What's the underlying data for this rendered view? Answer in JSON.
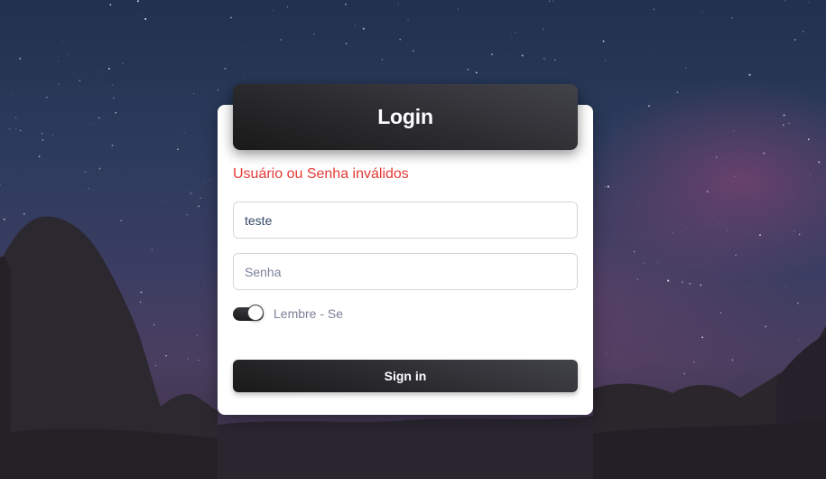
{
  "login": {
    "title": "Login",
    "error_message": "Usuário ou Senha inválidos",
    "username": {
      "value": "teste",
      "placeholder": ""
    },
    "password": {
      "value": "",
      "placeholder": "Senha"
    },
    "remember": {
      "label": "Lembre - Se",
      "checked": true
    },
    "signin_label": "Sign in"
  },
  "colors": {
    "error": "#e53935",
    "dark_gradient_start": "#42424a",
    "dark_gradient_end": "#191919"
  }
}
